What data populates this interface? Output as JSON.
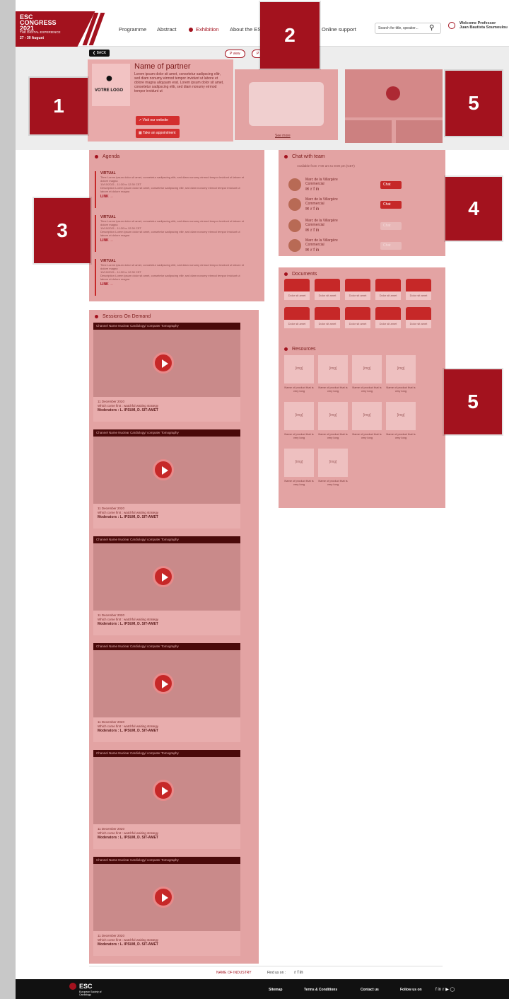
{
  "header": {
    "logo_lines": "ESC\nCONGRESS\n2021",
    "logo_sub": "THE DIGITAL EXPERIENCE",
    "logo_date": "27 - 30 August",
    "nav": [
      "Programme",
      "Abstract",
      "Exhibition",
      "About the ES",
      "Online support"
    ],
    "search_placeholder": "Search for title, speaker...",
    "welcome": "Welcome Professor\nJuan Bautista Soumoulou"
  },
  "hero": {
    "back": "BACK",
    "pill1": "P view",
    "pill2": "P",
    "partner_title": "Name of partner",
    "logo_text": "VOTRE LOGO",
    "desc": "Lorem ipsum dolor sit amet, consetetur sadipscing elitr, sed diam nonumy eirmod tempor invidunt ut labore et dolore magna aliquyam erat. Lorem ipsum dolor sit amet, consetetur sadipscing elitr, sed diam nonumy eirmod tempor invidunt ut",
    "btn_website": "Visit our website",
    "btn_appointment": "Take an appointment",
    "see_more": "See more"
  },
  "callouts": [
    "1",
    "2",
    "3",
    "4",
    "5",
    "5"
  ],
  "agenda": {
    "title": "Agenda",
    "items": [
      {
        "kind": "VIRTUAL",
        "text": "Time Lorem ipsum dolor sit amet, consetetur sadipscing elitr, sed diam nonumy eirmod tempor invidunt ut labore et dolore magna",
        "date": "10/10/2021 - 11:30 to 12:30 CET",
        "desc": "Description Lorem ipsum dolor sit amet, consetetur sadipscing elitr, sed diam nonumy eirmod tempor invidunt ut labore et dolore magna",
        "link": "LINK →"
      },
      {
        "kind": "VIRTUAL",
        "text": "Time Lorem ipsum dolor sit amet, consetetur sadipscing elitr, sed diam nonumy eirmod tempor invidunt ut labore et dolore magna",
        "date": "10/10/2021 - 11:30 to 12:30 CET",
        "desc": "Description Lorem ipsum dolor sit amet, consetetur sadipscing elitr, sed diam nonumy eirmod tempor invidunt ut labore et dolore magna",
        "link": "LINK →"
      },
      {
        "kind": "VIRTUAL",
        "text": "Time Lorem ipsum dolor sit amet, consetetur sadipscing elitr, sed diam nonumy eirmod tempor invidunt ut labore et dolore magna",
        "date": "10/10/2021 - 11:30 to 12:30 CET",
        "desc": "Description Lorem ipsum dolor sit amet, consetetur sadipscing elitr, sed diam nonumy eirmod tempor invidunt ut labore et dolore magna",
        "link": "LINK →"
      }
    ]
  },
  "chat": {
    "title": "Chat with team",
    "avail": "Available from 7:00 am to 8:00 pm (CET)",
    "rows": [
      {
        "name": "Marc de la Villargère",
        "role": "Commercial",
        "btn": "Chat"
      },
      {
        "name": "Marc de la Villargère",
        "role": "Commercial",
        "btn": "Chat"
      },
      {
        "name": "Marc de la Villargère",
        "role": "Commercial",
        "btn": "Chat"
      },
      {
        "name": "Marc de la Villargère",
        "role": "Commercial",
        "btn": "Chat"
      }
    ]
  },
  "documents": {
    "title": "Documents",
    "label": "Dolor sit amet"
  },
  "resources": {
    "title": "Resources",
    "img": "[img]",
    "label": "Name of product that is very long"
  },
  "sessions": {
    "title": "Sessions On Demand",
    "bar": "Channel Name Nuclear Cardiology/ computer Tomography",
    "date": "11 December 2020",
    "talk": "Which come first : watchful waiting strategy",
    "mods": "Moderators : L. IPSUM, D. SIT-AMET"
  },
  "footer": {
    "industry": "NAME OF INDUSTRY",
    "find": "Find us on :",
    "esc": "ESC",
    "esc_sub": "European Society of Cardiology",
    "links": [
      "Sitemap",
      "Terms & Conditions",
      "Contact us",
      "Follow us on"
    ]
  }
}
